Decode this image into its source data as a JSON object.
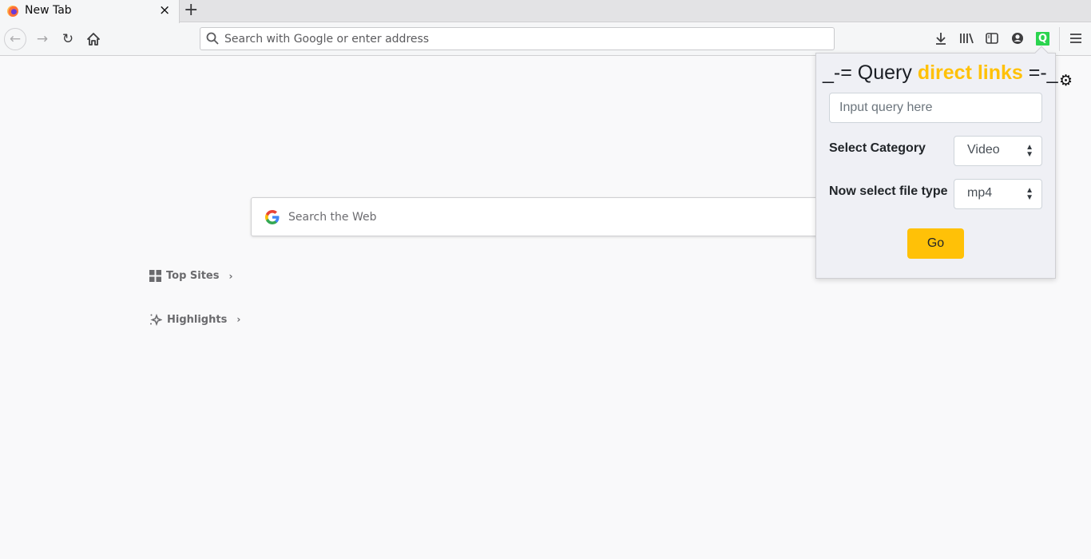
{
  "browser": {
    "tab": {
      "title": "New Tab",
      "close_label": "×"
    },
    "new_tab_label": "+",
    "urlbar": {
      "placeholder": "Search with Google or enter address",
      "value": ""
    },
    "toolbar_icons": [
      "download-icon",
      "library-icon",
      "sidebar-icon",
      "account-icon",
      "extension-q-icon",
      "hamburger-menu-icon"
    ],
    "extension_badge": "Q"
  },
  "newtab": {
    "search": {
      "placeholder": "Search the Web"
    },
    "sections": [
      {
        "label": "Top Sites",
        "icon": "grid-icon"
      },
      {
        "label": "Highlights",
        "icon": "sparkle-icon"
      }
    ]
  },
  "popup": {
    "title_prefix": "_-= Query ",
    "title_highlight": "direct links",
    "title_suffix": " =-_",
    "query": {
      "placeholder": "Input query here",
      "value": ""
    },
    "category_label": "Select Category",
    "category_value": "Video",
    "filetype_label": "Now select file type",
    "filetype_value": "mp4",
    "go_label": "Go",
    "accent_color": "#ffc107"
  }
}
